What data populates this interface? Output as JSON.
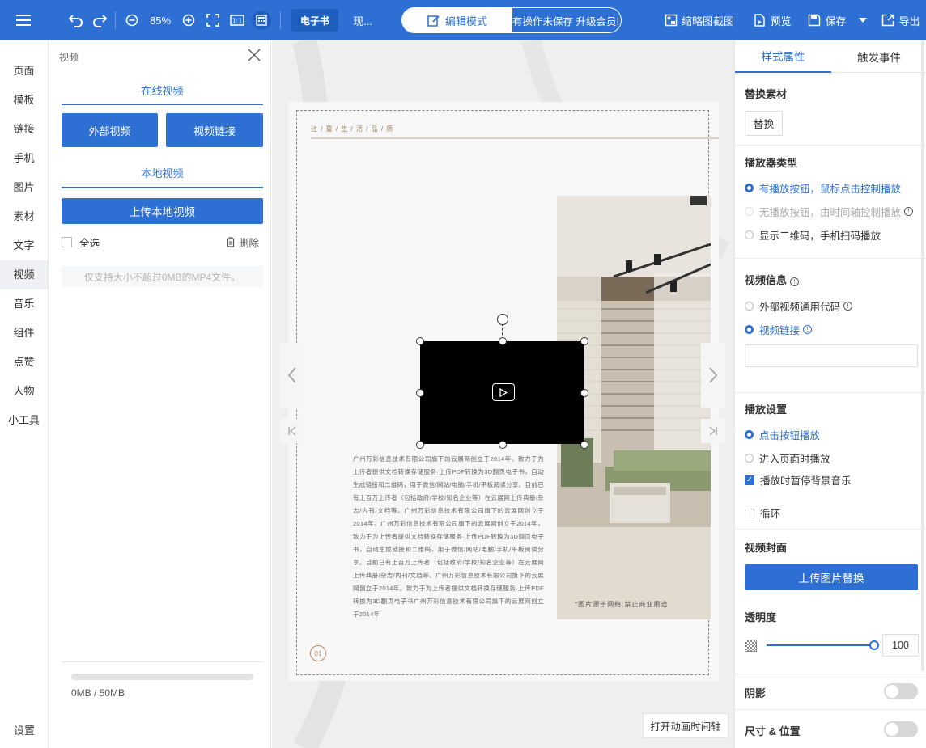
{
  "toolbar": {
    "zoom": "85%",
    "mode_tab": "电子书",
    "mode_tab2": "现...",
    "edit_mode": "编辑模式",
    "marquee": "有操作未保存 升级会员!",
    "thumbnail": "缩略图截图",
    "preview": "预览",
    "save": "保存",
    "export": "导出"
  },
  "leftnav": {
    "items": [
      "页面",
      "模板",
      "链接",
      "手机",
      "图片",
      "素材",
      "文字",
      "视频",
      "音乐",
      "组件",
      "点赞",
      "人物",
      "小工具"
    ],
    "settings": "设置"
  },
  "panel": {
    "title": "视频",
    "online_tab": "在线视频",
    "external_btn": "外部视频",
    "link_btn": "视频链接",
    "local_tab": "本地视频",
    "upload_btn": "上传本地视频",
    "select_all": "全选",
    "delete": "删除",
    "hint": "仅支持大小不超过0MB的MP4文件。",
    "storage": "0MB / 50MB"
  },
  "page": {
    "header": "注 / 重 / 生 / 活 / 品 / 质",
    "body_text": "广州万彩信息技术有限公司旗下的云展网创立于2014年。致力于为上传者提供文档转换存储服务·上传PDF转换为3D翻页电子书，自动生成链接和二维码，用于微信/网站/电脑/手机/平板阅读分享。目前已有上百万上传者（包括政府/学校/知名企业等）在云展网上传典册/杂志/内刊/文档等。广州万彩信息技术有限公司旗下的云展网创立于2014年。广州万彩信息技术有限公司旗下的云展网创立于2014年，致力于为上传者提供文档转换存储服务·上传PDF转换为3D翻页电子书，自动生成链接和二维码，用于微信/网站/电脑/手机/平板阅读分享。目前已有上百万上传者（包括政府/学校/知名企业等）在云展网上传典册/杂志/内刊/文档等。广州万彩信息技术有限公司旗下的云展网创立于2014年。致力于为上传者提供文档转换存储服务·上传PDF转换为3D翻页电子书广州万彩信息技术有限公司旗下的云展网创立于2014年",
    "caption": "*图片源于网络,禁止商业用途",
    "page_num": "01",
    "timeline_btn": "打开动画时间轴"
  },
  "right": {
    "tab_style": "样式属性",
    "tab_event": "触发事件",
    "replace_title": "替换素材",
    "replace_btn": "替换",
    "player_type_title": "播放器类型",
    "player_opt1": "有播放按钮，鼠标点击控制播放",
    "player_opt2": "无播放按钮，由时间轴控制播放",
    "player_opt3": "显示二维码，手机扫码播放",
    "video_info_title": "视频信息",
    "info_opt1": "外部视频通用代码",
    "info_opt2": "视频链接",
    "link_value": "",
    "play_settings_title": "播放设置",
    "play_opt1": "点击按钮播放",
    "play_opt2": "进入页面时播放",
    "pause_bgm": "播放时暂停背景音乐",
    "loop": "循环",
    "cover_title": "视频封面",
    "cover_btn": "上传图片替换",
    "opacity_title": "透明度",
    "opacity_value": "100",
    "shadow_title": "阴影",
    "size_pos_title": "尺寸 & 位置"
  },
  "colors": {
    "brand": "#2d6fd3"
  }
}
